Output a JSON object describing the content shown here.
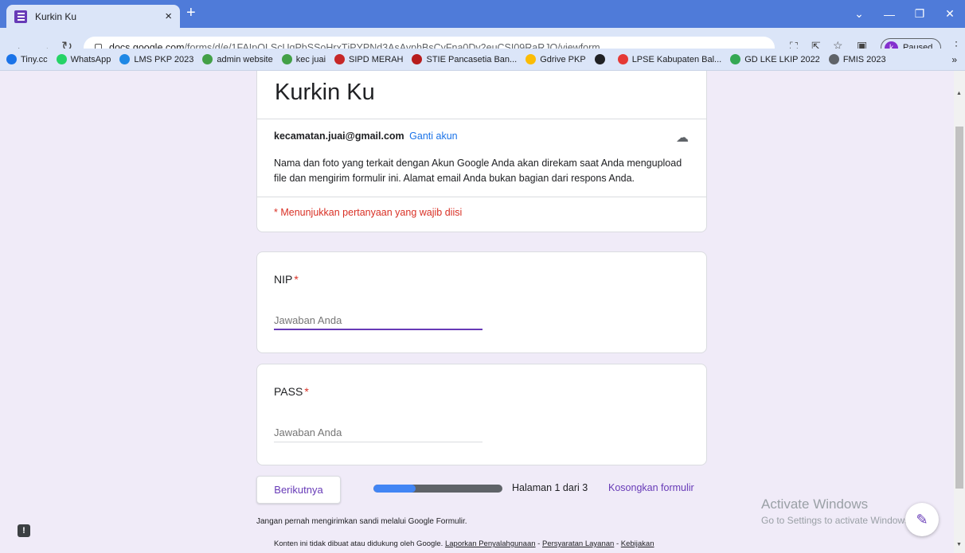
{
  "browser": {
    "tab_title": "Kurkin Ku",
    "tab_close": "×",
    "new_tab": "+",
    "url_host": "docs.google.com",
    "url_path": "/forms/d/e/1FAIpQLScUqPbSSoHrxTjPYPNd3AsAyphBsCyFna0Dv2euCSI09RaRJQ/viewform",
    "profile_initial": "k",
    "profile_status": "Paused",
    "bookmarks": [
      {
        "label": "Tiny.cc",
        "color": "#1a73e8"
      },
      {
        "label": "WhatsApp",
        "color": "#25d366"
      },
      {
        "label": "LMS PKP 2023",
        "color": "#1e88e5"
      },
      {
        "label": "admin website",
        "color": "#43a047"
      },
      {
        "label": "kec juai",
        "color": "#43a047"
      },
      {
        "label": "SIPD MERAH",
        "color": "#c62828"
      },
      {
        "label": "STIE Pancasetia Ban...",
        "color": "#b71c1c"
      },
      {
        "label": "Gdrive PKP",
        "color": "#fbbc04"
      },
      {
        "label": "",
        "color": "#202124"
      },
      {
        "label": "LPSE Kabupaten Bal...",
        "color": "#e53935"
      },
      {
        "label": "GD LKE LKIP 2022",
        "color": "#34a853"
      },
      {
        "label": "FMIS 2023",
        "color": "#5f6368"
      }
    ],
    "bookmarks_more": "»"
  },
  "form": {
    "title": "Kurkin Ku",
    "account_email": "kecamatan.juai@gmail.com",
    "switch_account": "Ganti akun",
    "notice": "Nama dan foto yang terkait dengan Akun Google Anda akan direkam saat Anda mengupload file dan mengirim formulir ini. Alamat email Anda bukan bagian dari respons Anda.",
    "required_note": "* Menunjukkan pertanyaan yang wajib diisi",
    "questions": [
      {
        "label": "NIP",
        "required": "*",
        "placeholder": "Jawaban Anda"
      },
      {
        "label": "PASS",
        "required": "*",
        "placeholder": "Jawaban Anda"
      }
    ],
    "next_button": "Berikutnya",
    "progress_fraction": 0.33,
    "page_indicator": "Halaman 1 dari 3",
    "clear_form": "Kosongkan formulir",
    "footer_warning": "Jangan pernah mengirimkan sandi melalui Google Formulir.",
    "footer_disclaimer": "Konten ini tidak dibuat atau didukung oleh Google.",
    "footer_links": [
      "Laporkan Penyalahgunaan",
      "Persyaratan Layanan",
      "Kebijakan"
    ]
  },
  "overlay": {
    "activate_title": "Activate Windows",
    "activate_sub": "Go to Settings to activate Windows."
  }
}
